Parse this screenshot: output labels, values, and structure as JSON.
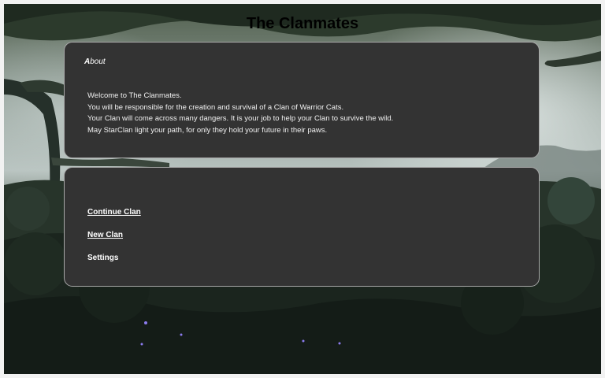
{
  "app": {
    "title": "The Clanmates"
  },
  "about": {
    "heading_first": "A",
    "heading_rest": "bout",
    "lines": [
      "Welcome to The Clanmates.",
      "You will be responsible for the creation and survival of a Clan of Warrior Cats.",
      "Your Clan will come across many dangers. It is your job to help your Clan to survive the wild.",
      "May StarClan light your path, for only they hold your future in their paws."
    ]
  },
  "menu": {
    "continue_label": "Continue Clan",
    "new_label": "New Clan",
    "settings_label": "Settings"
  },
  "colors": {
    "panel_background": "#333333",
    "panel_border": "#a8a8a8",
    "text": "#ffffff",
    "title": "#000000"
  }
}
